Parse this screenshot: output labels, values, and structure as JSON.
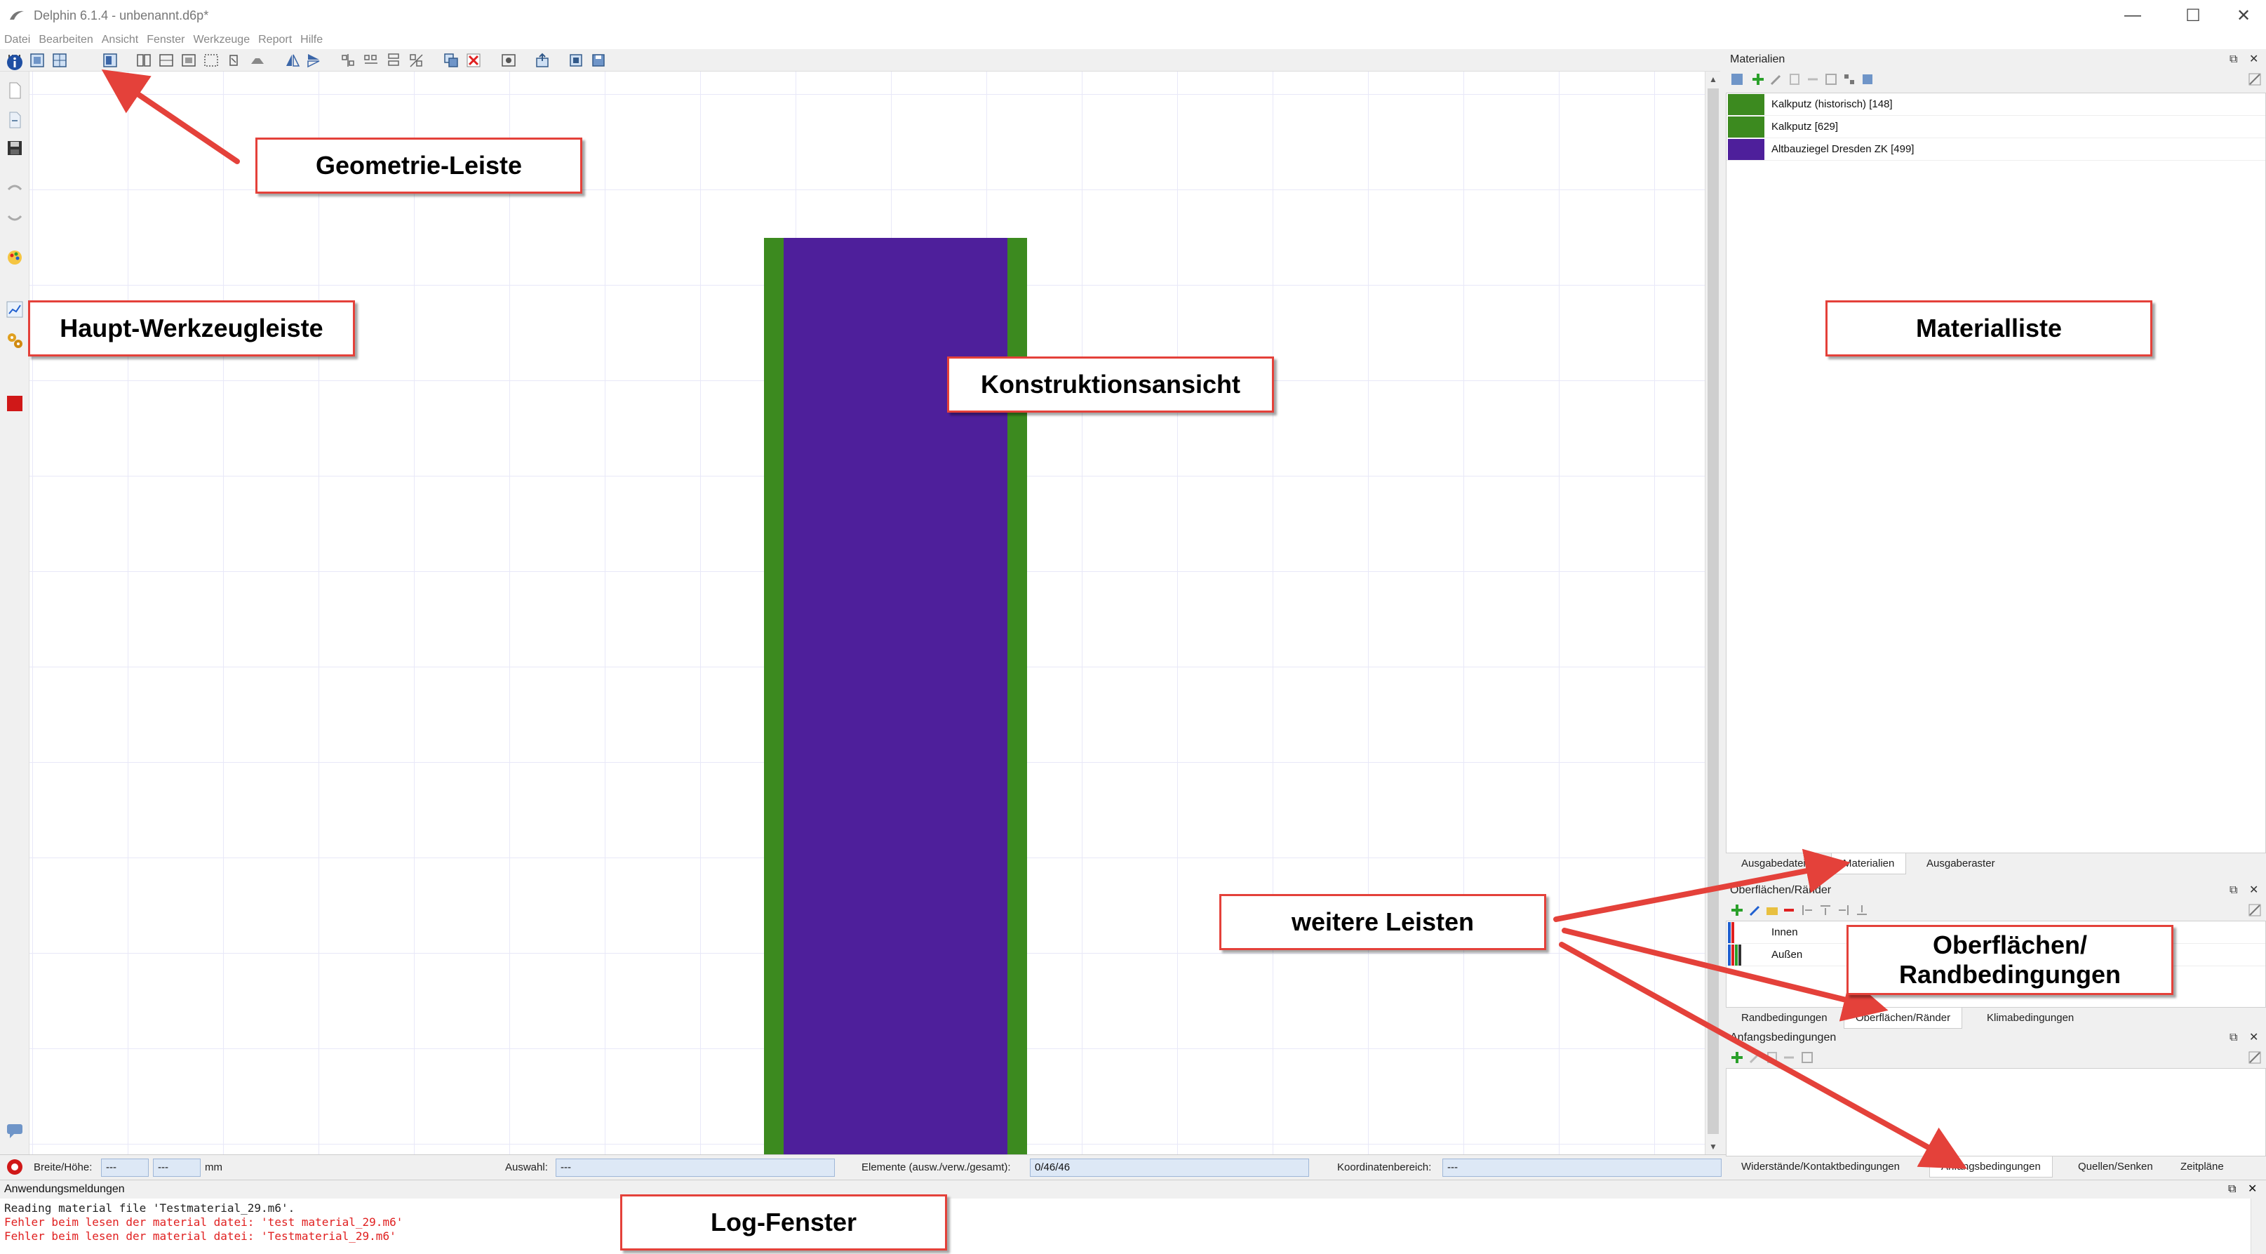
{
  "window": {
    "title": "Delphin 6.1.4 - unbenannt.d6p*",
    "minimize_glyph": "—",
    "maximize_glyph": "☐",
    "close_glyph": "✕"
  },
  "menu": [
    "Datei",
    "Bearbeiten",
    "Ansicht",
    "Fenster",
    "Werkzeuge",
    "Report",
    "Hilfe"
  ],
  "colors": {
    "plaster_green": "#3c8a1f",
    "brick_purple": "#4e1f9b",
    "annotation_red": "#e4413a",
    "field_blue": "#dde8f6"
  },
  "construction": {
    "layers": [
      {
        "material": "Kalkputz (historisch) [148]",
        "color": "#3c8a1f"
      },
      {
        "material": "Altbauziegel Dresden ZK [499]",
        "color": "#4e1f9b"
      },
      {
        "material": "Kalkputz [629]",
        "color": "#3c8a1f"
      }
    ]
  },
  "statusbar": {
    "breite_hoehe_label": "Breite/Höhe:",
    "breite_value": "---",
    "hoehe_value": "---",
    "unit": "mm",
    "auswahl_label": "Auswahl:",
    "auswahl_value": "---",
    "elemente_label": "Elemente (ausw./verw./gesamt):",
    "elemente_value": "0/46/46",
    "koordinaten_label": "Koordinatenbereich:",
    "koordinaten_value": "---"
  },
  "materials_panel": {
    "title": "Materialien",
    "items": [
      {
        "name": "Kalkputz (historisch) [148]",
        "color": "#3c8a1f"
      },
      {
        "name": "Kalkputz [629]",
        "color": "#3c8a1f"
      },
      {
        "name": "Altbauziegel Dresden ZK [499]",
        "color": "#4e1f9b"
      }
    ],
    "tabs": [
      "Ausgabedateien",
      "Materialien",
      "Ausgaberaster"
    ],
    "active_tab": "Materialien"
  },
  "surfaces_panel": {
    "title": "Oberflächen/Ränder",
    "items": [
      {
        "name": "Innen"
      },
      {
        "name": "Außen"
      }
    ],
    "tabs": [
      "Randbedingungen",
      "Oberflächen/Ränder",
      "Klimabedingungen"
    ],
    "active_tab": "Oberflächen/Ränder"
  },
  "initial_panel": {
    "title": "Anfangsbedingungen",
    "tabs": [
      "Widerstände/Kontaktbedingungen",
      "Anfangsbedingungen",
      "Quellen/Senken",
      "Zeitpläne"
    ],
    "active_tab": "Anfangsbedingungen"
  },
  "log": {
    "title": "Anwendungsmeldungen",
    "lines": [
      {
        "text": "Reading material file 'Testmaterial_29.m6'.",
        "color": "#222222"
      },
      {
        "text": "Fehler beim lesen der material datei: 'test material_29.m6'",
        "color": "#e02020"
      },
      {
        "text": "Fehler beim lesen der material datei: 'Testmaterial_29.m6'",
        "color": "#e02020"
      }
    ]
  },
  "annotations": {
    "geometrie": "Geometrie-Leiste",
    "haupt": "Haupt-Werkzeugleiste",
    "konstruktion": "Konstruktionsansicht",
    "materialliste": "Materialliste",
    "weitere": "weitere Leisten",
    "oberflaechen_line1": "Oberflächen/",
    "oberflaechen_line2": "Randbedingungen",
    "log": "Log-Fenster"
  },
  "icons": {
    "toolbar_top": [
      "grid-lines-icon",
      "geometry-icon-1",
      "geometry-icon-2",
      "geometry-icon-3",
      "split-icon",
      "merge-icon",
      "insert-icon",
      "select-icon",
      "rotate-icon",
      "bridge-icon",
      "mirror-vertical-icon",
      "mirror-horizontal-icon",
      "align-icon-1",
      "align-icon-2",
      "align-icon-3",
      "align-icon-4",
      "copy-icon",
      "delete-icon",
      "view-icon",
      "export-icon",
      "import-icon",
      "save-view-icon"
    ],
    "toolbar_left": [
      "info-icon",
      "new-file-icon",
      "open-file-icon",
      "save-icon",
      "undo-icon",
      "redo-icon",
      "palette-icon",
      "chart-icon",
      "settings-icon",
      "stop-icon",
      "chat-icon",
      "run-icon"
    ]
  }
}
